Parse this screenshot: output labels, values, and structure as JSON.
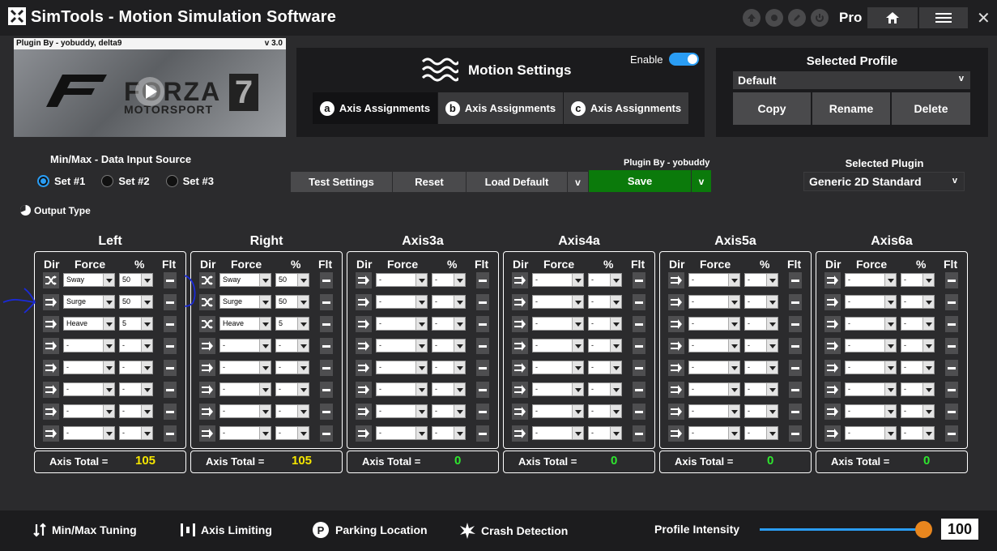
{
  "app": {
    "title": "SimTools - Motion Simulation Software",
    "edition": "Pro"
  },
  "plugin_card": {
    "author": "Plugin By - yobuddy, delta9",
    "version": "v 3.0",
    "game_line1": "FORZA",
    "game_line2": "MOTORSPORT",
    "game_number": "7"
  },
  "motion": {
    "title": "Motion Settings",
    "enable_label": "Enable",
    "enabled": true,
    "tabs": [
      {
        "badge": "a",
        "label": "Axis Assignments"
      },
      {
        "badge": "b",
        "label": "Axis Assignments"
      },
      {
        "badge": "c",
        "label": "Axis Assignments"
      }
    ]
  },
  "profile": {
    "title": "Selected Profile",
    "value": "Default",
    "copy": "Copy",
    "rename": "Rename",
    "delete": "Delete"
  },
  "input_source": {
    "title": "Min/Max - Data Input Source",
    "options": [
      "Set #1",
      "Set #2",
      "Set #3"
    ],
    "selected": "Set #1"
  },
  "output_type": "Output Type",
  "actions": {
    "plugin_by": "Plugin By - yobuddy",
    "test": "Test Settings",
    "reset": "Reset",
    "load_default": "Load Default",
    "chevron": "v",
    "save": "Save"
  },
  "plugin_select": {
    "title": "Selected Plugin",
    "value": "Generic 2D Standard"
  },
  "columns": {
    "dir": "Dir",
    "force": "Force",
    "pct": "%",
    "flt": "Flt"
  },
  "total_label": "Axis Total =",
  "axes": [
    {
      "name": "Left",
      "total": "105",
      "rows": [
        {
          "dir": "cross",
          "force": "Sway",
          "pct": "50"
        },
        {
          "dir": "arrow",
          "force": "Surge",
          "pct": "50"
        },
        {
          "dir": "arrow",
          "force": "Heave",
          "pct": "5"
        },
        {
          "dir": "arrow",
          "force": "-",
          "pct": "-"
        },
        {
          "dir": "arrow",
          "force": "-",
          "pct": "-"
        },
        {
          "dir": "arrow",
          "force": "-",
          "pct": "-"
        },
        {
          "dir": "arrow",
          "force": "-",
          "pct": "-"
        },
        {
          "dir": "arrow",
          "force": "-",
          "pct": "-"
        }
      ]
    },
    {
      "name": "Right",
      "total": "105",
      "rows": [
        {
          "dir": "cross",
          "force": "Sway",
          "pct": "50"
        },
        {
          "dir": "cross",
          "force": "Surge",
          "pct": "50"
        },
        {
          "dir": "cross",
          "force": "Heave",
          "pct": "5"
        },
        {
          "dir": "arrow",
          "force": "-",
          "pct": "-"
        },
        {
          "dir": "arrow",
          "force": "-",
          "pct": "-"
        },
        {
          "dir": "arrow",
          "force": "-",
          "pct": "-"
        },
        {
          "dir": "arrow",
          "force": "-",
          "pct": "-"
        },
        {
          "dir": "arrow",
          "force": "-",
          "pct": "-"
        }
      ]
    },
    {
      "name": "Axis3a",
      "total": "0",
      "rows": [
        {
          "dir": "arrow",
          "force": "-",
          "pct": "-"
        },
        {
          "dir": "arrow",
          "force": "-",
          "pct": "-"
        },
        {
          "dir": "arrow",
          "force": "-",
          "pct": "-"
        },
        {
          "dir": "arrow",
          "force": "-",
          "pct": "-"
        },
        {
          "dir": "arrow",
          "force": "-",
          "pct": "-"
        },
        {
          "dir": "arrow",
          "force": "-",
          "pct": "-"
        },
        {
          "dir": "arrow",
          "force": "-",
          "pct": "-"
        },
        {
          "dir": "arrow",
          "force": "-",
          "pct": "-"
        }
      ]
    },
    {
      "name": "Axis4a",
      "total": "0",
      "rows": [
        {
          "dir": "arrow",
          "force": "-",
          "pct": "-"
        },
        {
          "dir": "arrow",
          "force": "-",
          "pct": "-"
        },
        {
          "dir": "arrow",
          "force": "-",
          "pct": "-"
        },
        {
          "dir": "arrow",
          "force": "-",
          "pct": "-"
        },
        {
          "dir": "arrow",
          "force": "-",
          "pct": "-"
        },
        {
          "dir": "arrow",
          "force": "-",
          "pct": "-"
        },
        {
          "dir": "arrow",
          "force": "-",
          "pct": "-"
        },
        {
          "dir": "arrow",
          "force": "-",
          "pct": "-"
        }
      ]
    },
    {
      "name": "Axis5a",
      "total": "0",
      "rows": [
        {
          "dir": "arrow",
          "force": "-",
          "pct": "-"
        },
        {
          "dir": "arrow",
          "force": "-",
          "pct": "-"
        },
        {
          "dir": "arrow",
          "force": "-",
          "pct": "-"
        },
        {
          "dir": "arrow",
          "force": "-",
          "pct": "-"
        },
        {
          "dir": "arrow",
          "force": "-",
          "pct": "-"
        },
        {
          "dir": "arrow",
          "force": "-",
          "pct": "-"
        },
        {
          "dir": "arrow",
          "force": "-",
          "pct": "-"
        },
        {
          "dir": "arrow",
          "force": "-",
          "pct": "-"
        }
      ]
    },
    {
      "name": "Axis6a",
      "total": "0",
      "rows": [
        {
          "dir": "arrow",
          "force": "-",
          "pct": "-"
        },
        {
          "dir": "arrow",
          "force": "-",
          "pct": "-"
        },
        {
          "dir": "arrow",
          "force": "-",
          "pct": "-"
        },
        {
          "dir": "arrow",
          "force": "-",
          "pct": "-"
        },
        {
          "dir": "arrow",
          "force": "-",
          "pct": "-"
        },
        {
          "dir": "arrow",
          "force": "-",
          "pct": "-"
        },
        {
          "dir": "arrow",
          "force": "-",
          "pct": "-"
        },
        {
          "dir": "arrow",
          "force": "-",
          "pct": "-"
        }
      ]
    }
  ],
  "bottom": {
    "minmax": "Min/Max Tuning",
    "limiting": "Axis Limiting",
    "parking": "Parking Location",
    "crash": "Crash Detection",
    "intensity_label": "Profile Intensity",
    "intensity_value": "100",
    "intensity_fraction": 1.0
  },
  "colors": {
    "accent": "#2a9df4",
    "save_green": "#0b7a0b",
    "total_nonzero": "#f5e600",
    "total_zero": "#2ee62e",
    "slider_thumb": "#e8861e",
    "slider_track": "#2a9df4"
  }
}
